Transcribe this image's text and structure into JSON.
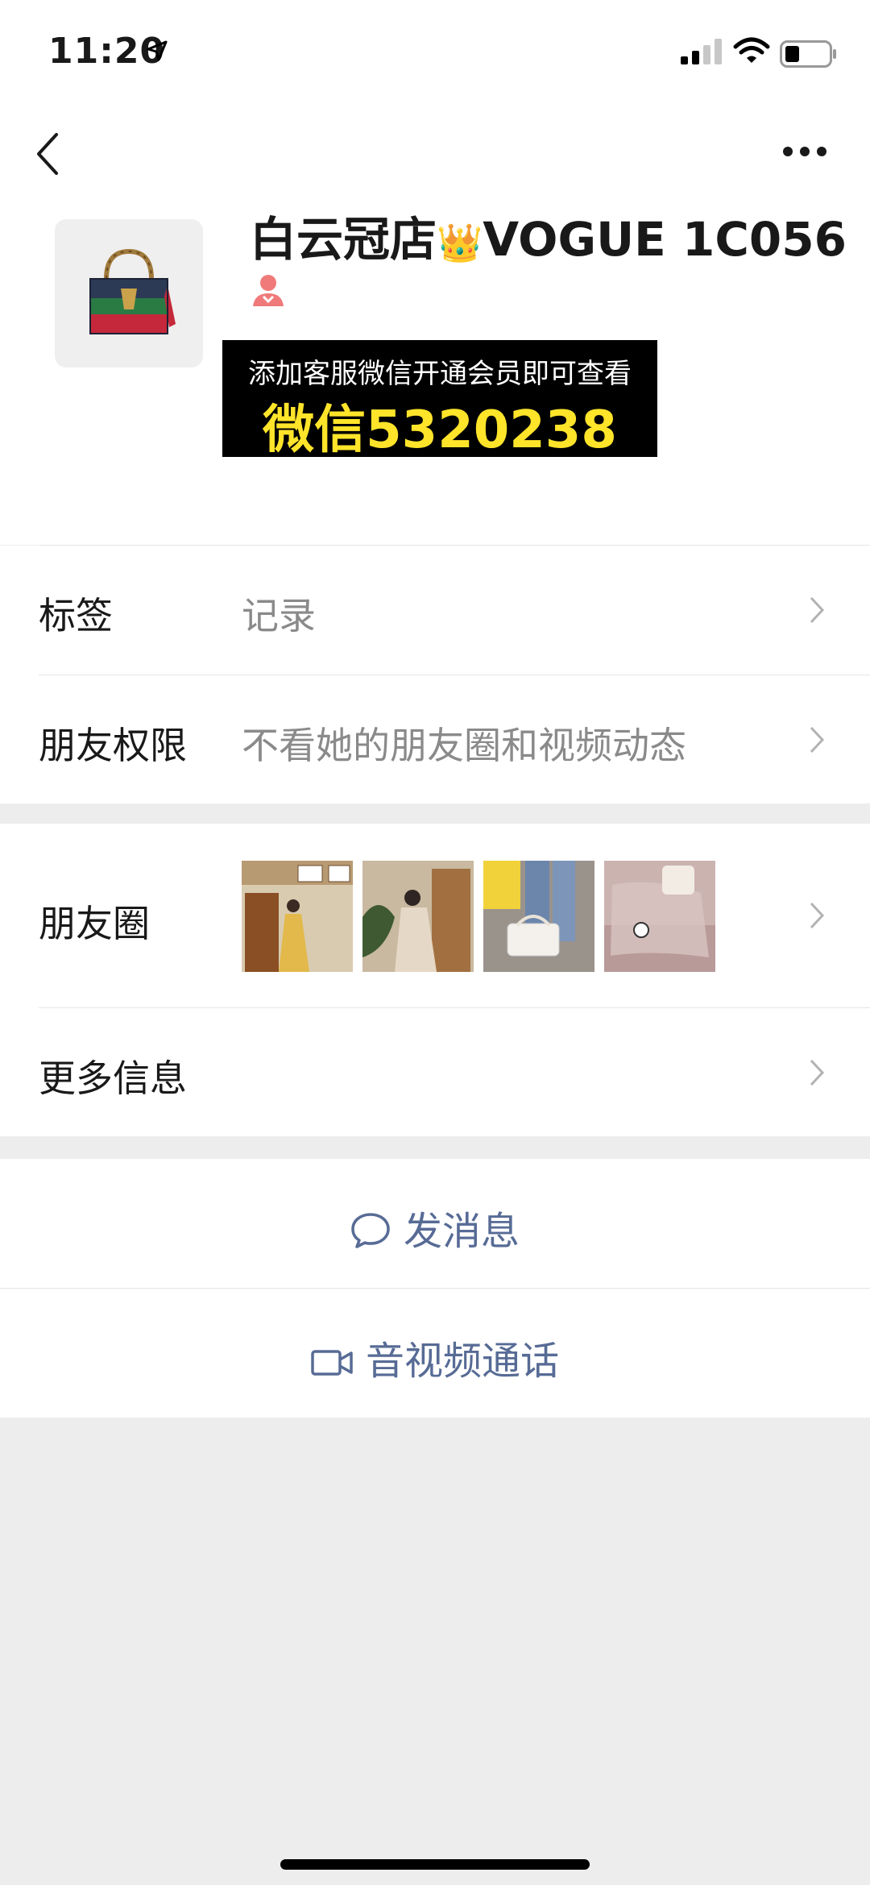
{
  "status_bar": {
    "time": "11:20",
    "icons": [
      "location-arrow-icon",
      "cellular-signal-icon",
      "wifi-icon",
      "battery-icon"
    ]
  },
  "nav": {
    "back_icon": "chevron-left-icon",
    "more_icon": "more-dots-icon"
  },
  "profile": {
    "name": "白云冠店",
    "name_suffix": "VOGUE 1C056",
    "crown_emoji": "👑",
    "gender_icon": "female-user-icon",
    "avatar": "handbag-image"
  },
  "banner": {
    "line1": "添加客服微信开通会员即可查看",
    "line2": "微信5320238",
    "text_color": "#ffe42a"
  },
  "rows": {
    "tags": {
      "label": "标签",
      "value": "记录"
    },
    "permissions": {
      "label": "朋友权限",
      "value": "不看她的朋友圈和视频动态"
    },
    "moments": {
      "label": "朋友圈"
    },
    "more_info": {
      "label": "更多信息"
    }
  },
  "actions": {
    "message": "发消息",
    "call": "音视频通话",
    "color": "#576b95"
  }
}
